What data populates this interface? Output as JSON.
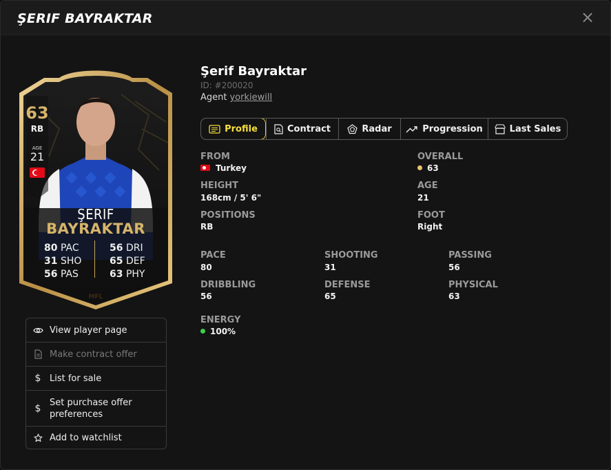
{
  "modal": {
    "title": "ŞERIF BAYRAKTAR",
    "close_label": "×"
  },
  "card": {
    "overall": "63",
    "position": "RB",
    "age_label": "AGE",
    "age": "21",
    "first_name": "ŞERIF",
    "last_name": "BAYRAKTAR",
    "stats": [
      {
        "value": "80",
        "label": "PAC"
      },
      {
        "value": "31",
        "label": "SHO"
      },
      {
        "value": "56",
        "label": "PAS"
      },
      {
        "value": "56",
        "label": "DRI"
      },
      {
        "value": "65",
        "label": "DEF"
      },
      {
        "value": "63",
        "label": "PHY"
      }
    ],
    "logo_text": "MFL"
  },
  "menu": [
    {
      "label": "View player page",
      "icon": "eye-icon",
      "enabled": true
    },
    {
      "label": "Make contract offer",
      "icon": "document-icon",
      "enabled": false
    },
    {
      "label": "List for sale",
      "icon": "dollar-icon",
      "enabled": true
    },
    {
      "label": "Set purchase offer preferences",
      "icon": "dollar-icon",
      "enabled": true
    },
    {
      "label": "Add to watchlist",
      "icon": "star-icon",
      "enabled": true
    }
  ],
  "player": {
    "name": "Şerif Bayraktar",
    "id": "ID: #200020",
    "agent_label": "Agent",
    "agent_name": "yorkiewill"
  },
  "tabs": [
    {
      "label": "Profile",
      "icon": "profile-icon",
      "active": true
    },
    {
      "label": "Contract",
      "icon": "contract-icon",
      "active": false
    },
    {
      "label": "Radar",
      "icon": "radar-icon",
      "active": false
    },
    {
      "label": "Progression",
      "icon": "progression-icon",
      "active": false
    },
    {
      "label": "Last Sales",
      "icon": "shop-icon",
      "active": false
    }
  ],
  "profile": {
    "from_label": "FROM",
    "from_value": "Turkey",
    "overall_label": "OVERALL",
    "overall_value": "63",
    "height_label": "HEIGHT",
    "height_value": "168cm / 5' 6\"",
    "age_label": "AGE",
    "age_value": "21",
    "positions_label": "POSITIONS",
    "positions_value": "RB",
    "foot_label": "FOOT",
    "foot_value": "Right",
    "pace_label": "PACE",
    "pace_value": "80",
    "shooting_label": "SHOOTING",
    "shooting_value": "31",
    "passing_label": "PASSING",
    "passing_value": "56",
    "dribbling_label": "DRIBBLING",
    "dribbling_value": "56",
    "defense_label": "DEFENSE",
    "defense_value": "65",
    "physical_label": "PHYSICAL",
    "physical_value": "63",
    "energy_label": "ENERGY",
    "energy_value": "100%"
  },
  "colors": {
    "gold": "#d6b46a",
    "accent_yellow": "#f6df3c",
    "overall_dot": "#e8c46d",
    "energy_dot": "#3ad14a",
    "turkey_red": "#e30a17"
  }
}
